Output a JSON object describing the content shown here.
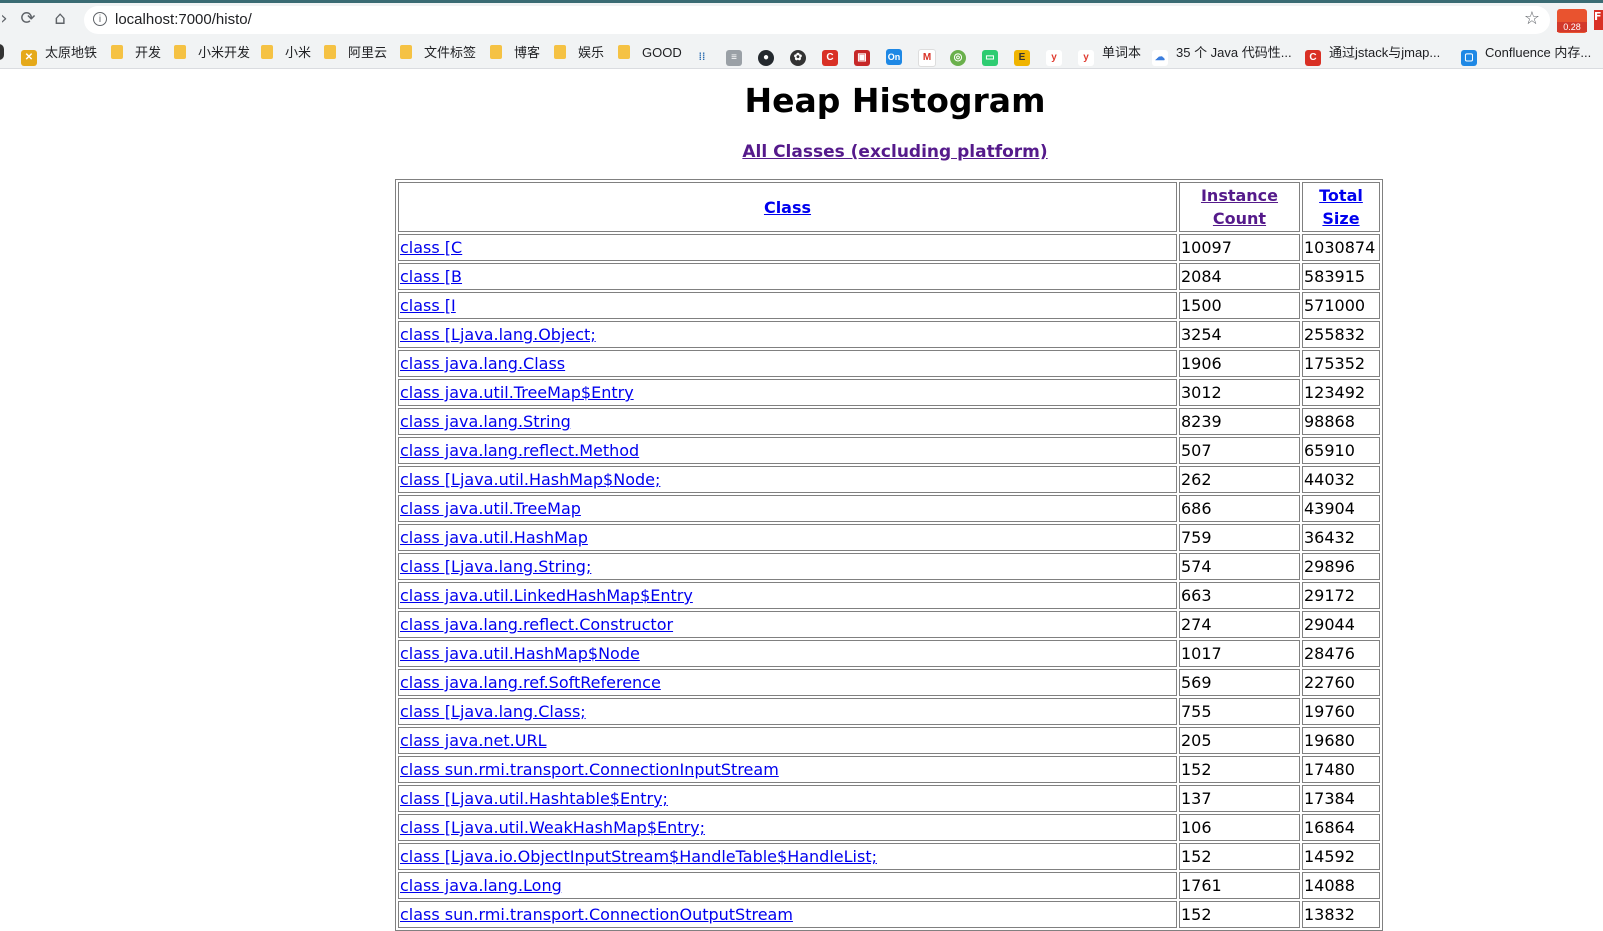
{
  "browser": {
    "url": "localhost:7000/histo/",
    "extension_badge": "0.28"
  },
  "bookmarks": [
    {
      "label": "太原地铁",
      "type": "app",
      "color": "#e5a91a"
    },
    {
      "label": "开发",
      "type": "folder"
    },
    {
      "label": "小米开发",
      "type": "folder"
    },
    {
      "label": "小米",
      "type": "folder"
    },
    {
      "label": "阿里云",
      "type": "folder"
    },
    {
      "label": "文件标签",
      "type": "folder"
    },
    {
      "label": "博客",
      "type": "folder"
    },
    {
      "label": "娱乐",
      "type": "folder"
    },
    {
      "label": "GOOD",
      "type": "folder"
    },
    {
      "label": "单词本",
      "type": "icon",
      "color": "#e03c31"
    },
    {
      "label": "35 个 Java 代码性...",
      "type": "icon",
      "color": "#3b7ddd"
    },
    {
      "label": "通过jstack与jmap...",
      "type": "icon",
      "color": "#d93025"
    },
    {
      "label": "Confluence 内存...",
      "type": "icon",
      "color": "#1e88e5"
    }
  ],
  "page": {
    "title": "Heap Histogram",
    "subtitle_link": "All Classes (excluding platform)",
    "table": {
      "headers": [
        "Class",
        "Instance Count",
        "Total Size"
      ],
      "rows": [
        [
          "class [C",
          "10097",
          "1030874"
        ],
        [
          "class [B",
          "2084",
          "583915"
        ],
        [
          "class [I",
          "1500",
          "571000"
        ],
        [
          "class [Ljava.lang.Object;",
          "3254",
          "255832"
        ],
        [
          "class java.lang.Class",
          "1906",
          "175352"
        ],
        [
          "class java.util.TreeMap$Entry",
          "3012",
          "123492"
        ],
        [
          "class java.lang.String",
          "8239",
          "98868"
        ],
        [
          "class java.lang.reflect.Method",
          "507",
          "65910"
        ],
        [
          "class [Ljava.util.HashMap$Node;",
          "262",
          "44032"
        ],
        [
          "class java.util.TreeMap",
          "686",
          "43904"
        ],
        [
          "class java.util.HashMap",
          "759",
          "36432"
        ],
        [
          "class [Ljava.lang.String;",
          "574",
          "29896"
        ],
        [
          "class java.util.LinkedHashMap$Entry",
          "663",
          "29172"
        ],
        [
          "class java.lang.reflect.Constructor",
          "274",
          "29044"
        ],
        [
          "class java.util.HashMap$Node",
          "1017",
          "28476"
        ],
        [
          "class java.lang.ref.SoftReference",
          "569",
          "22760"
        ],
        [
          "class [Ljava.lang.Class;",
          "755",
          "19760"
        ],
        [
          "class java.net.URL",
          "205",
          "19680"
        ],
        [
          "class sun.rmi.transport.ConnectionInputStream",
          "152",
          "17480"
        ],
        [
          "class [Ljava.util.Hashtable$Entry;",
          "137",
          "17384"
        ],
        [
          "class [Ljava.util.WeakHashMap$Entry;",
          "106",
          "16864"
        ],
        [
          "class [Ljava.io.ObjectInputStream$HandleTable$HandleList;",
          "152",
          "14592"
        ],
        [
          "class java.lang.Long",
          "1761",
          "14088"
        ],
        [
          "class sun.rmi.transport.ConnectionOutputStream",
          "152",
          "13832"
        ]
      ]
    }
  }
}
